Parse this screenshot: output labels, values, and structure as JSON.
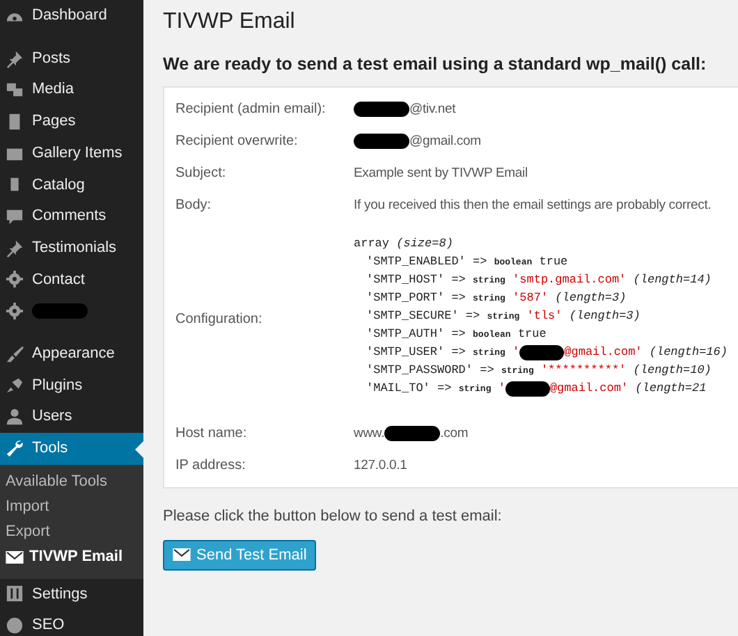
{
  "sidebar": {
    "groups": [
      {
        "items": [
          {
            "label": "Dashboard",
            "selected": false
          }
        ]
      },
      {
        "items": [
          {
            "label": "Posts",
            "selected": false
          },
          {
            "label": "Media",
            "selected": false
          },
          {
            "label": "Pages",
            "selected": false
          },
          {
            "label": "Gallery Items",
            "selected": false
          },
          {
            "label": "Catalog",
            "selected": false
          },
          {
            "label": "Comments",
            "selected": false
          },
          {
            "label": "Testimonials",
            "selected": false
          },
          {
            "label": "Contact",
            "selected": false
          },
          {
            "redacted": true,
            "selected": false
          }
        ]
      },
      {
        "items": [
          {
            "label": "Appearance",
            "selected": false
          },
          {
            "label": "Plugins",
            "selected": false
          },
          {
            "label": "Users",
            "selected": false
          },
          {
            "label": "Tools",
            "selected": true,
            "children": [
              {
                "label": "Available Tools",
                "selected": false
              },
              {
                "label": "Import",
                "selected": false
              },
              {
                "label": "Export",
                "selected": false
              },
              {
                "label": "TIVWP Email",
                "selected": true
              }
            ]
          },
          {
            "label": "Settings",
            "selected": false
          },
          {
            "label": "SEO",
            "selected": false
          }
        ]
      }
    ]
  },
  "page": {
    "title": "TIVWP Email",
    "heading": "We are ready to send a test email using a standard wp_mail() call:",
    "rows": [
      {
        "label": "Recipient (admin email):",
        "parts": [
          {
            "kind": "redaction"
          },
          {
            "kind": "text",
            "text": "@tiv.net"
          }
        ]
      },
      {
        "label": "Recipient overwrite:",
        "parts": [
          {
            "kind": "redaction"
          },
          {
            "kind": "text",
            "text": "@gmail.com"
          }
        ]
      },
      {
        "label": "Subject:",
        "parts": [
          {
            "kind": "text",
            "text": "Example sent by TIVWP Email"
          }
        ]
      },
      {
        "label": "Body:",
        "parts": [
          {
            "kind": "text",
            "text": "If you received this then the email settings are probably correct."
          }
        ]
      },
      {
        "label": "Configuration:",
        "code": {
          "tokens": [
            {
              "kind": "plain",
              "text": "array"
            },
            {
              "kind": "note",
              "text": "(size=8)"
            }
          ],
          "children": [
            {
              "tokens": [
                {
                  "kind": "plain",
                  "text": "'SMTP_ENABLED' =>"
                },
                {
                  "kind": "type",
                  "text": "boolean"
                },
                {
                  "kind": "bool",
                  "text": "true"
                }
              ]
            },
            {
              "tokens": [
                {
                  "kind": "plain",
                  "text": "'SMTP_HOST' =>"
                },
                {
                  "kind": "type",
                  "text": "string"
                },
                {
                  "kind": "string",
                  "text": "'smtp.gmail.com'"
                },
                {
                  "kind": "note",
                  "text": "(length=14)"
                }
              ]
            },
            {
              "tokens": [
                {
                  "kind": "plain",
                  "text": "'SMTP_PORT' =>"
                },
                {
                  "kind": "type",
                  "text": "string"
                },
                {
                  "kind": "string",
                  "text": "'587'"
                },
                {
                  "kind": "note",
                  "text": "(length=3)"
                }
              ]
            },
            {
              "tokens": [
                {
                  "kind": "plain",
                  "text": "'SMTP_SECURE' =>"
                },
                {
                  "kind": "type",
                  "text": "string"
                },
                {
                  "kind": "string",
                  "text": "'tls'"
                },
                {
                  "kind": "note",
                  "text": "(length=3)"
                }
              ]
            },
            {
              "tokens": [
                {
                  "kind": "plain",
                  "text": "'SMTP_AUTH' =>"
                },
                {
                  "kind": "type",
                  "text": "boolean"
                },
                {
                  "kind": "bool",
                  "text": "true"
                }
              ]
            },
            {
              "tokens": [
                {
                  "kind": "plain",
                  "text": "'SMTP_USER' =>"
                },
                {
                  "kind": "type",
                  "text": "string"
                },
                {
                  "kind": "string",
                  "text": "'"
                },
                {
                  "kind": "redaction"
                },
                {
                  "kind": "string",
                  "text": "@gmail.com'"
                },
                {
                  "kind": "note",
                  "text": "(length=16)"
                }
              ]
            },
            {
              "tokens": [
                {
                  "kind": "plain",
                  "text": "'SMTP_PASSWORD' =>"
                },
                {
                  "kind": "type",
                  "text": "string"
                },
                {
                  "kind": "string",
                  "text": "'**********'"
                },
                {
                  "kind": "note",
                  "text": "(length=10)"
                }
              ]
            },
            {
              "tokens": [
                {
                  "kind": "plain",
                  "text": "'MAIL_TO' =>"
                },
                {
                  "kind": "type",
                  "text": "string"
                },
                {
                  "kind": "string",
                  "text": "'"
                },
                {
                  "kind": "redaction"
                },
                {
                  "kind": "string",
                  "text": "@gmail.com'"
                },
                {
                  "kind": "note",
                  "text": "(length=21"
                }
              ]
            }
          ]
        }
      },
      {
        "label": "Host name:",
        "parts": [
          {
            "kind": "text",
            "text": "www."
          },
          {
            "kind": "redaction"
          },
          {
            "kind": "text",
            "text": ".com"
          }
        ]
      },
      {
        "label": "IP address:",
        "parts": [
          {
            "kind": "text",
            "text": "127.0.0.1"
          }
        ]
      }
    ],
    "note": "Please click the button below to send a test email:",
    "button": "Send Test Email"
  }
}
